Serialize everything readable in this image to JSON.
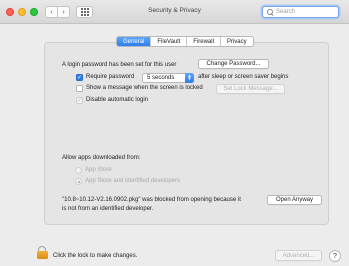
{
  "window": {
    "title": "Security & Privacy"
  },
  "toolbar": {
    "back_glyph": "‹",
    "forward_glyph": "›",
    "search_placeholder": "Search"
  },
  "tabs": [
    {
      "label": "General",
      "active": true
    },
    {
      "label": "FileVault",
      "active": false
    },
    {
      "label": "Firewall",
      "active": false
    },
    {
      "label": "Privacy",
      "active": false
    }
  ],
  "general": {
    "password_set_text": "A login password has been set for this user",
    "change_password_label": "Change Password...",
    "require_password_label": "Require password",
    "require_password_delay": "5 seconds",
    "after_sleep_text": "after sleep or screen saver begins",
    "show_message_label": "Show a message when the screen is locked",
    "set_lock_message_label": "Set Lock Message...",
    "disable_auto_login_label": "Disable automatic login",
    "checkmark": "✓"
  },
  "downloads": {
    "heading": "Allow apps downloaded from:",
    "option_app_store": "App Store",
    "option_identified": "App Store and identified developers",
    "blocked_line1": "\"10.8~10.12-V2.16.0902.pkg\" was blocked from opening because it",
    "blocked_line2": "is not from an identified developer.",
    "open_anyway_label": "Open Anyway"
  },
  "footer": {
    "lock_text": "Click the lock to make changes.",
    "advanced_label": "Advanced...",
    "help_label": "?"
  },
  "colors": {
    "accent": "#2f7ee8",
    "close": "#ff5f57",
    "minimize": "#febc2e",
    "maximize": "#28c840",
    "lock": "#e59c26"
  }
}
